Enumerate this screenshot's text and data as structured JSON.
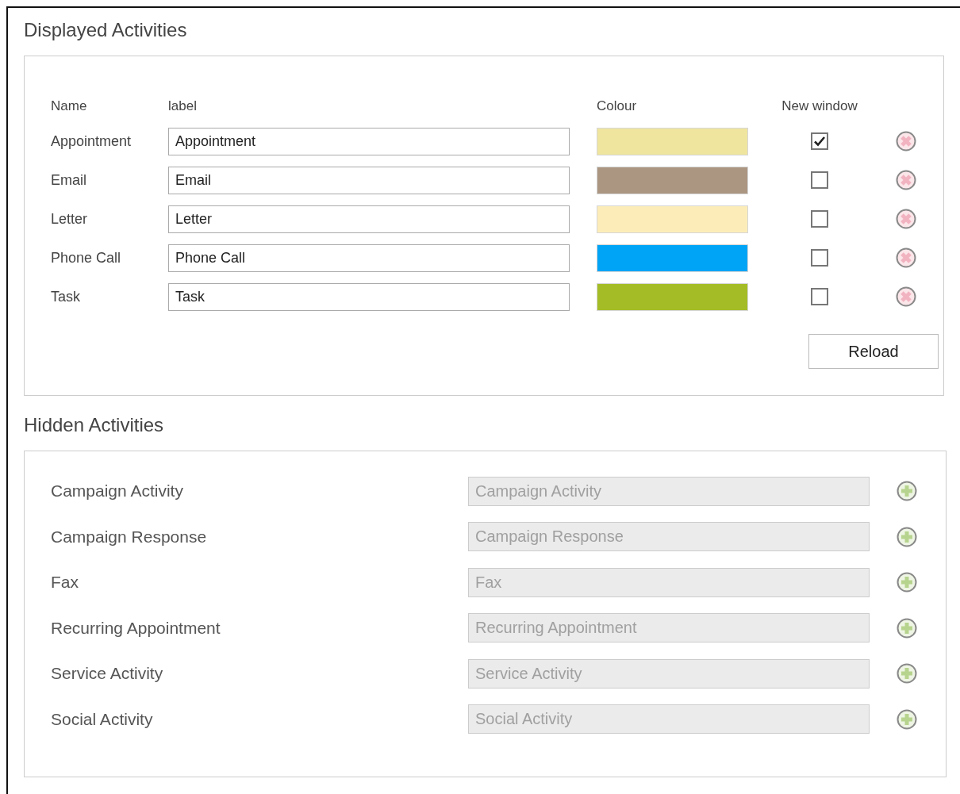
{
  "displayed": {
    "title": "Displayed Activities",
    "columns": [
      "Name",
      "label",
      "Colour",
      "New window"
    ],
    "rows": [
      {
        "name": "Appointment",
        "label": "Appointment",
        "color": "#efe59f",
        "new_window": true
      },
      {
        "name": "Email",
        "label": "Email",
        "color": "#ab9682",
        "new_window": false
      },
      {
        "name": "Letter",
        "label": "Letter",
        "color": "#fcedb8",
        "new_window": false
      },
      {
        "name": "Phone Call",
        "label": "Phone Call",
        "color": "#00a4f6",
        "new_window": false
      },
      {
        "name": "Task",
        "label": "Task",
        "color": "#a4bd26",
        "new_window": false
      }
    ],
    "reload_button": "Reload"
  },
  "hidden": {
    "title": "Hidden Activities",
    "rows": [
      {
        "name": "Campaign Activity",
        "label": "Campaign Activity",
        "disabled": true
      },
      {
        "name": "Campaign Response",
        "label": "Campaign Response",
        "disabled": true
      },
      {
        "name": "Fax",
        "label": "Fax",
        "disabled": true
      },
      {
        "name": "Recurring Appointment",
        "label": "Recurring Appointment",
        "disabled": true
      },
      {
        "name": "Service Activity",
        "label": "Service Activity",
        "disabled": true
      },
      {
        "name": "Social Activity",
        "label": "Social Activity",
        "disabled": true
      }
    ]
  }
}
